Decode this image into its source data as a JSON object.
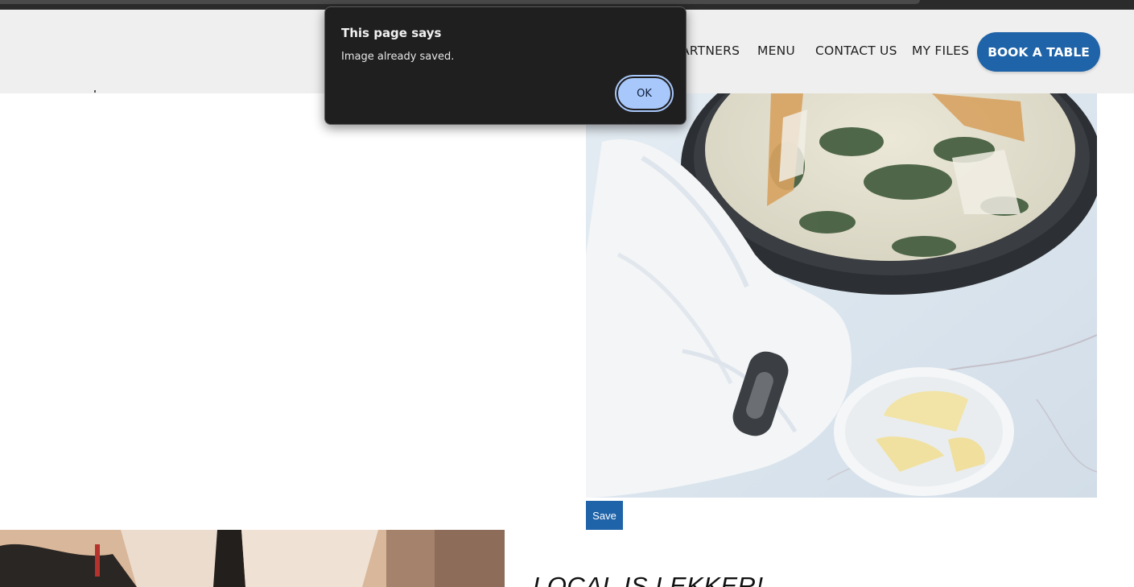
{
  "header": {
    "nav": {
      "partners": "ARTNERS",
      "menu": "MENU",
      "contact": "CONTACT US",
      "files": "MY FILES"
    },
    "cta": "BOOK A TABLE"
  },
  "gallery": {
    "save_label": "Save"
  },
  "section": {
    "heading": "LOCAL IS LEKKER!"
  },
  "dialog": {
    "title": "This page says",
    "message": "Image already saved.",
    "ok_label": "OK"
  },
  "colors": {
    "brand_blue": "#1f63a8",
    "dialog_bg": "#1f1f1f",
    "ok_button": "#a8c7fa",
    "header_bg": "#efefef"
  },
  "icons": {
    "food_photo": "fish-skillet-photo",
    "chef_photo": "chef-photo"
  }
}
